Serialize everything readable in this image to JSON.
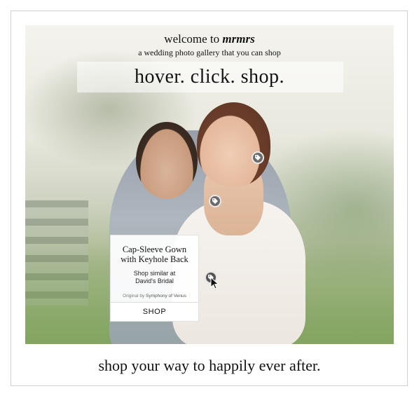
{
  "header": {
    "welcome_prefix": "welcome to",
    "brand": "mrmrs",
    "subtitle": "a wedding photo gallery that you can shop",
    "headline": "hover. click. shop."
  },
  "tags": [
    {
      "icon": "tag-icon"
    },
    {
      "icon": "tag-icon"
    },
    {
      "icon": "tag-icon"
    }
  ],
  "popup": {
    "title": "Cap-Sleeve Gown with Keyhole Back",
    "similar_line1": "Shop similar at",
    "similar_line2": "David's Bridal",
    "original_prefix": "Original by",
    "original_source": "Symphony of Venus",
    "shop_label": "SHOP"
  },
  "footer": {
    "tagline": "shop your way to happily ever after."
  },
  "colors": {
    "text": "#111111",
    "frame_border": "#d0d0d0",
    "tag_fill": "#6b6b6b"
  }
}
